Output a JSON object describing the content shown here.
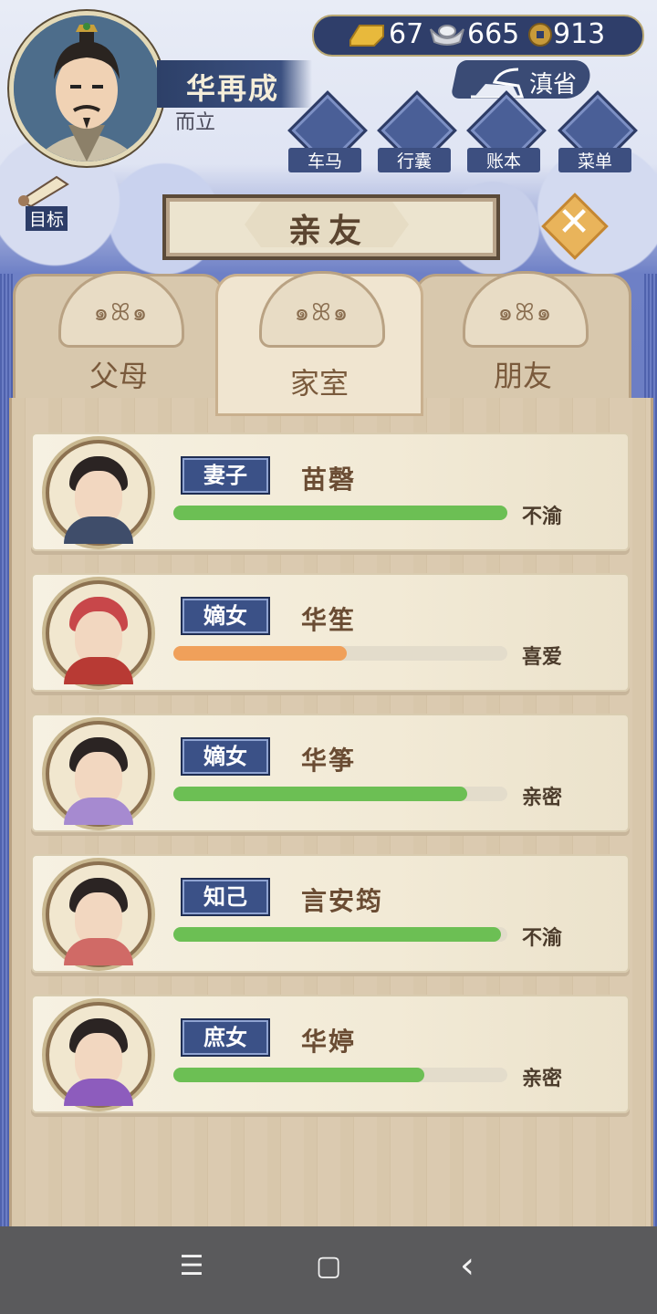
{
  "player": {
    "name": "华再成",
    "age_title": "而立"
  },
  "currency": {
    "gold": "67",
    "silver": "665",
    "coins": "913"
  },
  "region": "滇省",
  "menu": [
    {
      "label": "车马",
      "icon": "carriage-icon"
    },
    {
      "label": "行囊",
      "icon": "bag-icon"
    },
    {
      "label": "账本",
      "icon": "ledger-icon"
    },
    {
      "label": "菜单",
      "icon": "more-icon"
    }
  ],
  "goal_label": "目标",
  "title": "亲友",
  "tabs": [
    {
      "label": "父母",
      "active": false
    },
    {
      "label": "家室",
      "active": true
    },
    {
      "label": "朋友",
      "active": false
    }
  ],
  "relatives": [
    {
      "relation": "妻子",
      "name": "苗磬",
      "status": "不渝",
      "affinity": 1.0,
      "bar_color": "#6cbf54",
      "robe_color": "#3f4d6a"
    },
    {
      "relation": "嫡女",
      "name": "华笙",
      "status": "喜爱",
      "affinity": 0.52,
      "bar_color": "#f0a05a",
      "robe_color": "#b83a34"
    },
    {
      "relation": "嫡女",
      "name": "华筝",
      "status": "亲密",
      "affinity": 0.88,
      "bar_color": "#6cbf54",
      "robe_color": "#a68ad0"
    },
    {
      "relation": "知己",
      "name": "言安筠",
      "status": "不渝",
      "affinity": 0.98,
      "bar_color": "#6cbf54",
      "robe_color": "#d06a66"
    },
    {
      "relation": "庶女",
      "name": "华婷",
      "status": "亲密",
      "affinity": 0.75,
      "bar_color": "#6cbf54",
      "robe_color": "#8d5cbd"
    }
  ],
  "nav": {
    "menu": "☰",
    "home": "▢",
    "back": "‹"
  }
}
